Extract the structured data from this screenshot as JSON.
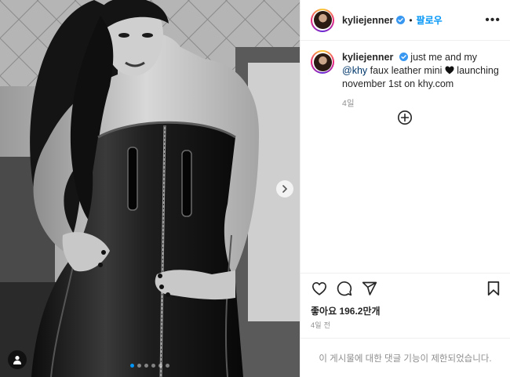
{
  "post": {
    "author": {
      "username": "kyliejenner",
      "verified": true
    },
    "header": {
      "separator": "•",
      "follow_label": "팔로우",
      "more_label": "•••"
    },
    "caption": {
      "username": "kyliejenner",
      "text_before_mention": " just me and my ",
      "mention": "@khy",
      "text_line_2": " faux leather mini ",
      "text_after_emoji": " launching november 1st on khy.com",
      "emoji": "black-heart",
      "time": "4일"
    },
    "stats": {
      "likes_label": "좋아요 196.2만개",
      "posted_time": "4일 전"
    },
    "comment_bar": {
      "text": "이 게시물에 대한 댓글 기능이 제한되었습니다."
    },
    "carousel": {
      "slide_count": 6,
      "active_index": 0
    },
    "icons": {
      "like": "heart-outline-icon",
      "comment": "speech-bubble-icon",
      "share": "paper-plane-icon",
      "save": "bookmark-icon",
      "load_more": "plus-circle-icon",
      "next": "chevron-right-icon",
      "tagged": "user-silhouette-icon"
    },
    "colors": {
      "accent": "#0095f6",
      "verified": "#3897f0",
      "text": "#262626",
      "muted": "#8e8e8e",
      "mention": "#00376b"
    }
  }
}
